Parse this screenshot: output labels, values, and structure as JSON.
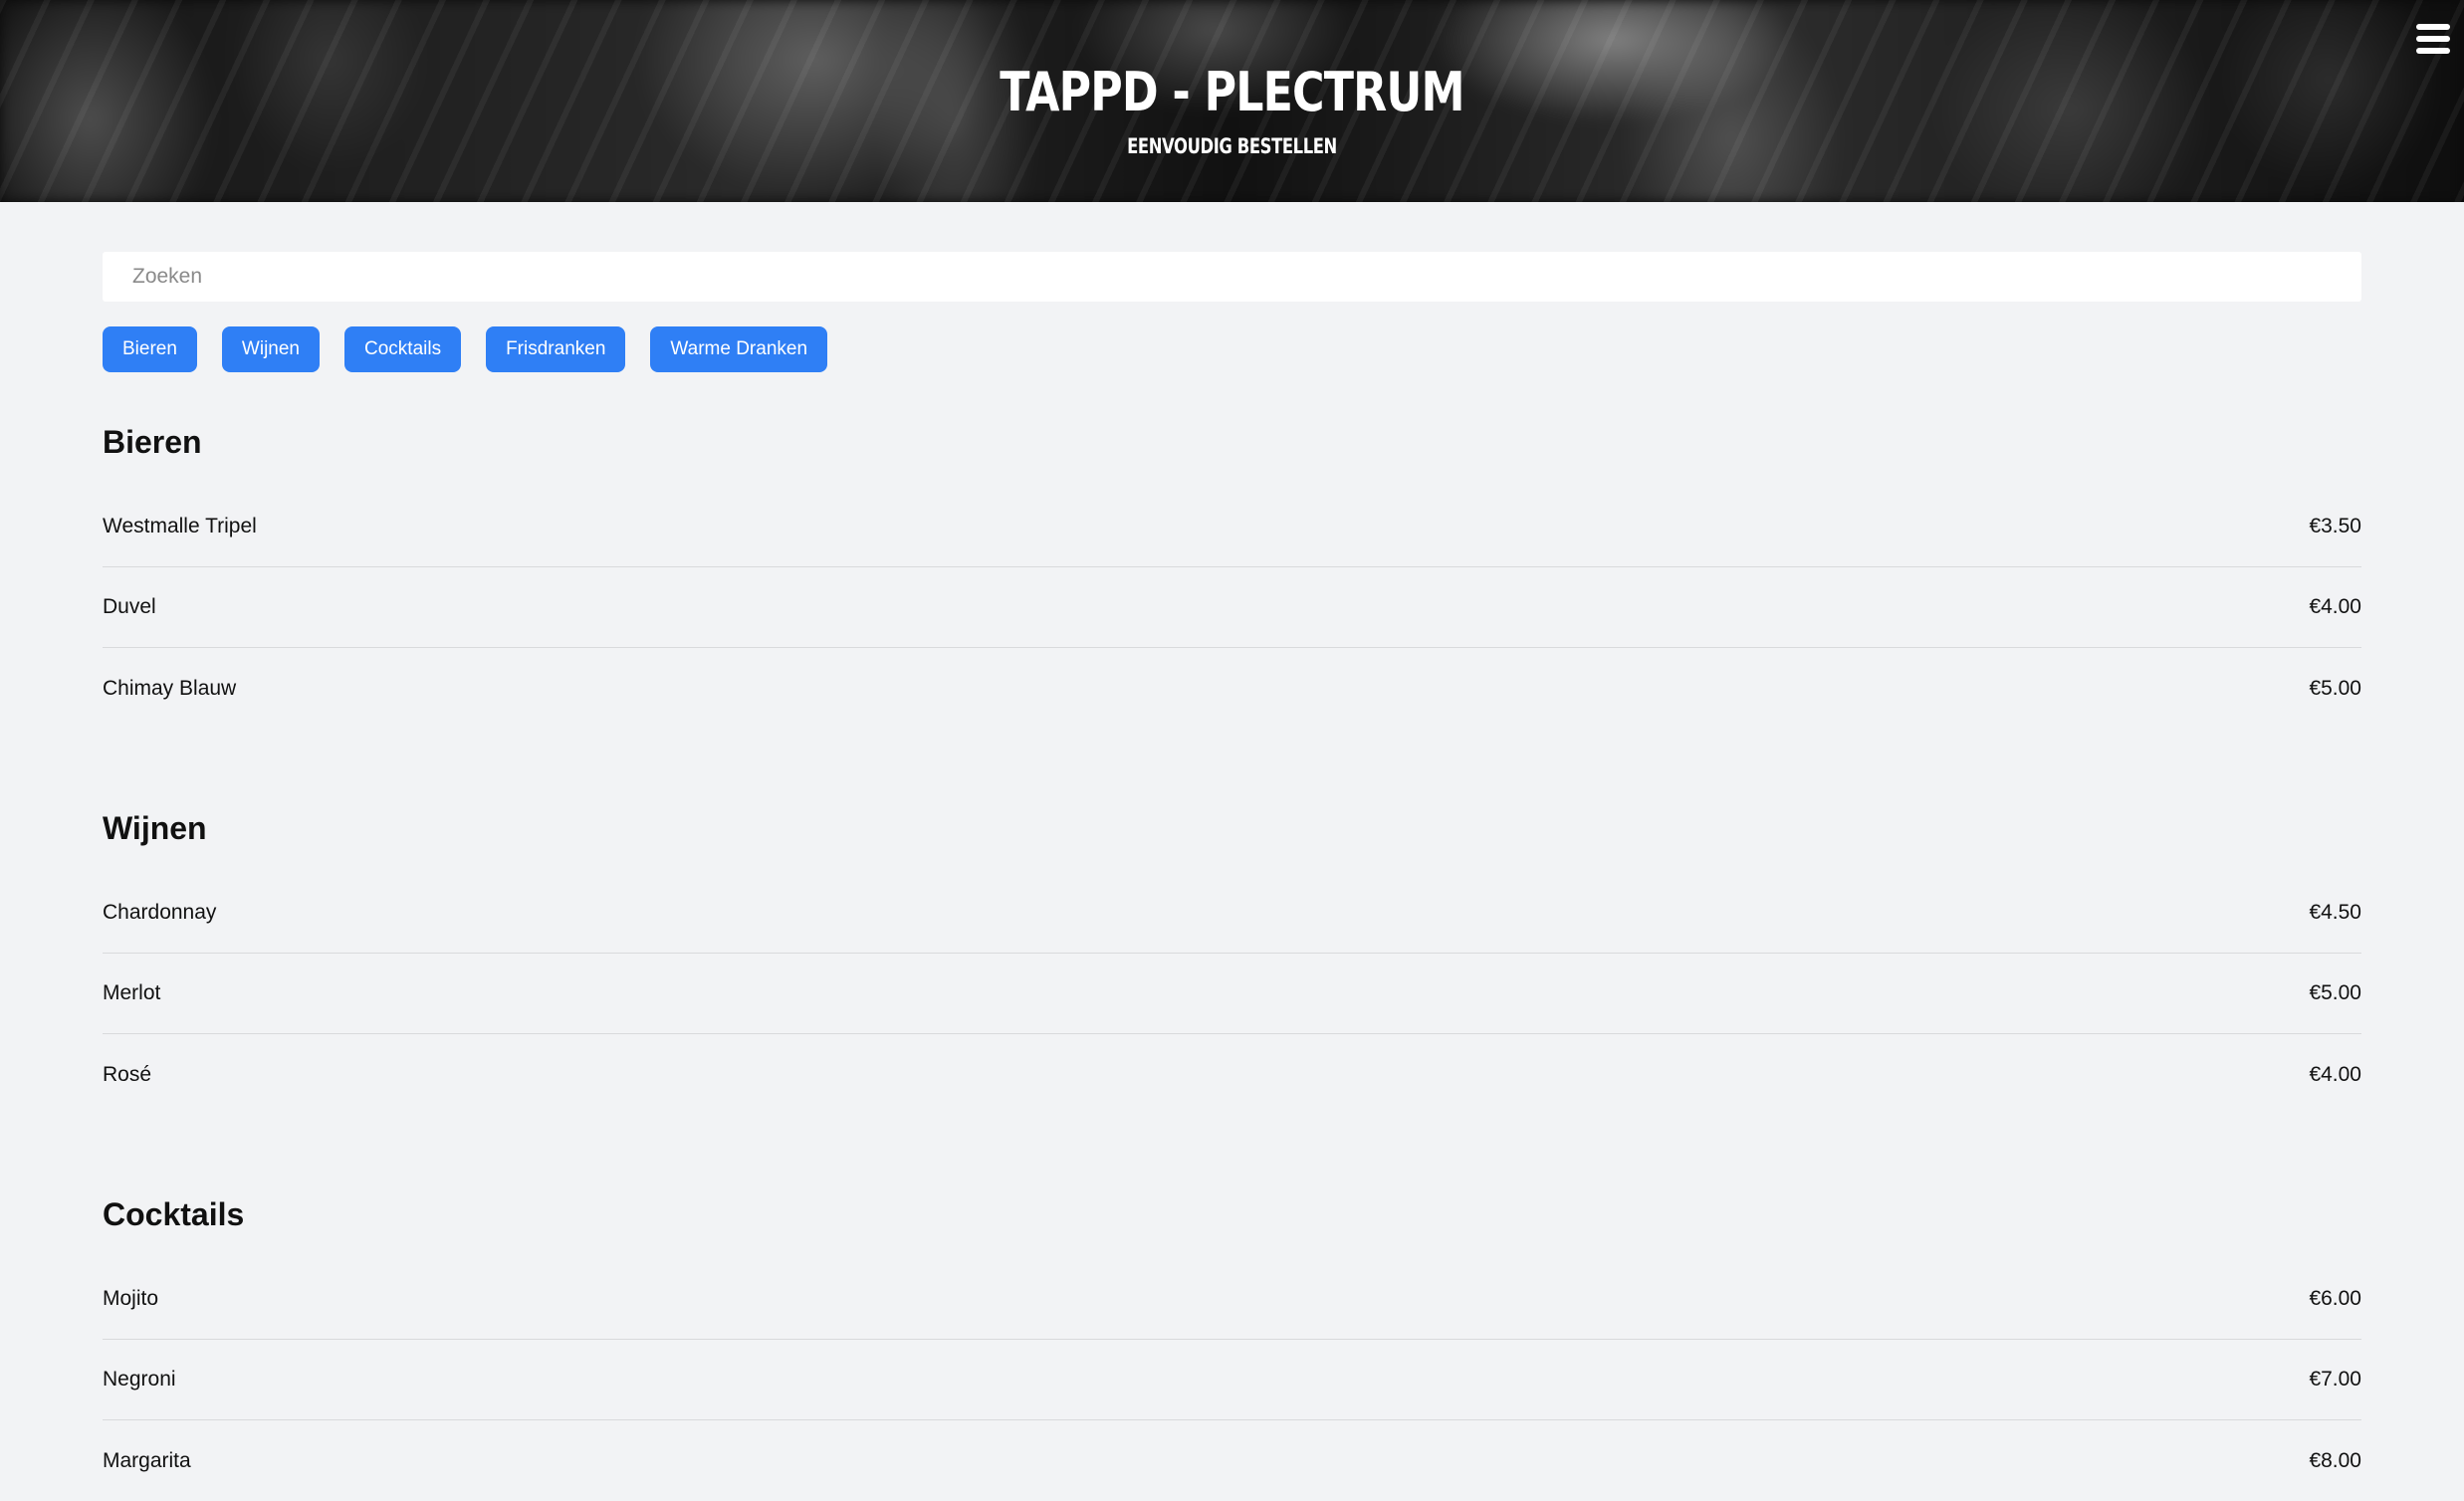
{
  "header": {
    "title": "TAPPD - PLECTRUM",
    "subtitle": "EENVOUDIG BESTELLEN",
    "menu_icon": "hamburger-menu-icon"
  },
  "search": {
    "placeholder": "Zoeken",
    "value": ""
  },
  "categories": [
    "Bieren",
    "Wijnen",
    "Cocktails",
    "Frisdranken",
    "Warme Dranken"
  ],
  "colors": {
    "accent": "#2f7ff5",
    "background": "#f2f3f5",
    "divider": "#d9dadc"
  },
  "sections": [
    {
      "title": "Bieren",
      "items": [
        {
          "name": "Westmalle Tripel",
          "price": "€3.50"
        },
        {
          "name": "Duvel",
          "price": "€4.00"
        },
        {
          "name": "Chimay Blauw",
          "price": "€5.00"
        }
      ]
    },
    {
      "title": "Wijnen",
      "items": [
        {
          "name": "Chardonnay",
          "price": "€4.50"
        },
        {
          "name": "Merlot",
          "price": "€5.00"
        },
        {
          "name": "Rosé",
          "price": "€4.00"
        }
      ]
    },
    {
      "title": "Cocktails",
      "items": [
        {
          "name": "Mojito",
          "price": "€6.00"
        },
        {
          "name": "Negroni",
          "price": "€7.00"
        },
        {
          "name": "Margarita",
          "price": "€8.00"
        }
      ]
    }
  ]
}
